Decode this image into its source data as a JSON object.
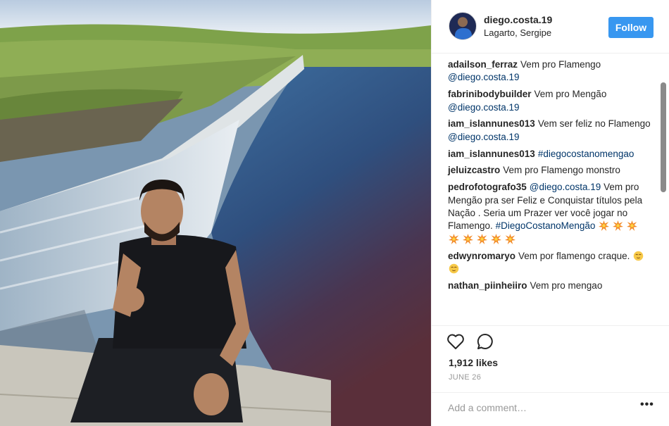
{
  "post": {
    "username": "diego.costa.19",
    "location": "Lagarto, Sergipe",
    "follow_label": "Follow",
    "likes": "1,912 likes",
    "date": "JUNE 26",
    "add_comment_placeholder": "Add a comment…",
    "more_label": "•••"
  },
  "comments": [
    {
      "user": "adailson_ferraz",
      "text": "Vem pro Flamengo",
      "mention": "@diego.costa.19",
      "trail": ""
    },
    {
      "user": "fabrinibodybuilder",
      "text": "Vem pro Mengão",
      "mention": "@diego.costa.19",
      "trail": ""
    },
    {
      "user": "iam_islannunes013",
      "text": "Vem ser feliz no Flamengo",
      "mention": "@diego.costa.19",
      "trail": ""
    },
    {
      "user": "iam_islannunes013",
      "text": "",
      "mention": "#diegocostanomengao",
      "trail": ""
    },
    {
      "user": "jeluizcastro",
      "text": "Vem pro Flamengo monstro",
      "mention": "",
      "trail": ""
    },
    {
      "user": "pedrofotografo35",
      "text": "",
      "mention": "@diego.costa.19",
      "trail": "Vem pro Mengão pra ser Feliz e Conquistar títulos pela Nação . Seria um Prazer ver você jogar no Flamengo."
    },
    {
      "user": "edwynromaryo",
      "text": "Vem por flamengo craque.",
      "mention": "",
      "trail": ""
    },
    {
      "user": "nathan_piinheiiro",
      "text": "Vem pro mengao",
      "mention": "",
      "trail": ""
    }
  ],
  "pedro_hashtag": "#DiegoCostanoMengão",
  "icons": {
    "like": "heart-icon",
    "comment": "comment-bubble-icon",
    "more": "more-options-icon",
    "boom": "collision-emoji",
    "relieved": "relieved-face-emoji"
  },
  "colors": {
    "follow_button": "#3897f0",
    "link": "#003569",
    "muted": "#999999",
    "border": "#efefef"
  }
}
